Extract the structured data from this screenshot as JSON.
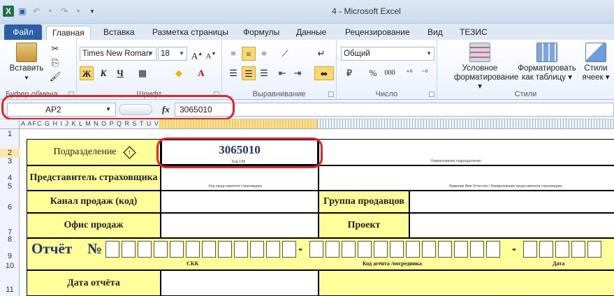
{
  "window": {
    "title": "4 - Microsoft Excel"
  },
  "qat": {
    "icons": [
      "excel-logo-icon",
      "save-icon",
      "undo-icon",
      "redo-icon",
      "customize-qat-icon"
    ]
  },
  "tabs": [
    "Файл",
    "Главная",
    "Вставка",
    "Разметка страницы",
    "Формулы",
    "Данные",
    "Рецензирование",
    "Вид",
    "ТЕЗИС"
  ],
  "ribbon": {
    "clipboard": {
      "label": "Буфер обмена",
      "paste": "Вставить"
    },
    "font": {
      "label": "Шрифт",
      "name": "Times New Roman",
      "size": "18",
      "bold": "Ж",
      "italic": "К",
      "underline": "Ч"
    },
    "alignment": {
      "label": "Выравнивание"
    },
    "number": {
      "label": "Число",
      "format": "Общий",
      "percent": "%",
      "thousands": "000"
    },
    "styles": {
      "label": "Стили",
      "conditional": "Условное форматирование",
      "table": "Форматировать как таблицу",
      "cell_styles": "Стили ячеек"
    }
  },
  "formula_bar": {
    "name_box": "AP2",
    "fx": "fx",
    "value": "3065010"
  },
  "sheet": {
    "col_letters": "A AFC G  H  I  J K L M N O P Q R S T U V",
    "rows": [
      "1",
      "2",
      "3",
      "4",
      "5",
      "6",
      "7",
      "8",
      "9",
      "10",
      "11"
    ],
    "labels": {
      "division": "Подразделение",
      "division_value": "3065010",
      "insurer_rep": "Представитель страховщика",
      "sales_channel": "Канал продаж (код)",
      "sales_group": "Группа продавцов",
      "sales_office": "Офис продаж",
      "project": "Проект",
      "report": "Отчёт",
      "number_sign": "№",
      "dash": "-",
      "skk": "СКК",
      "agent_code": "Код агента /посредника",
      "date": "Дата",
      "report_date": "Дата отчёта"
    },
    "small_captions": {
      "skk_code": "Код СКК",
      "division_name": "Наименование подразделения",
      "rep_code": "Код представителя страховщика",
      "rep_name": "Фамилия  Имя  Отчество  /  Наименование представителя страховщика"
    }
  }
}
